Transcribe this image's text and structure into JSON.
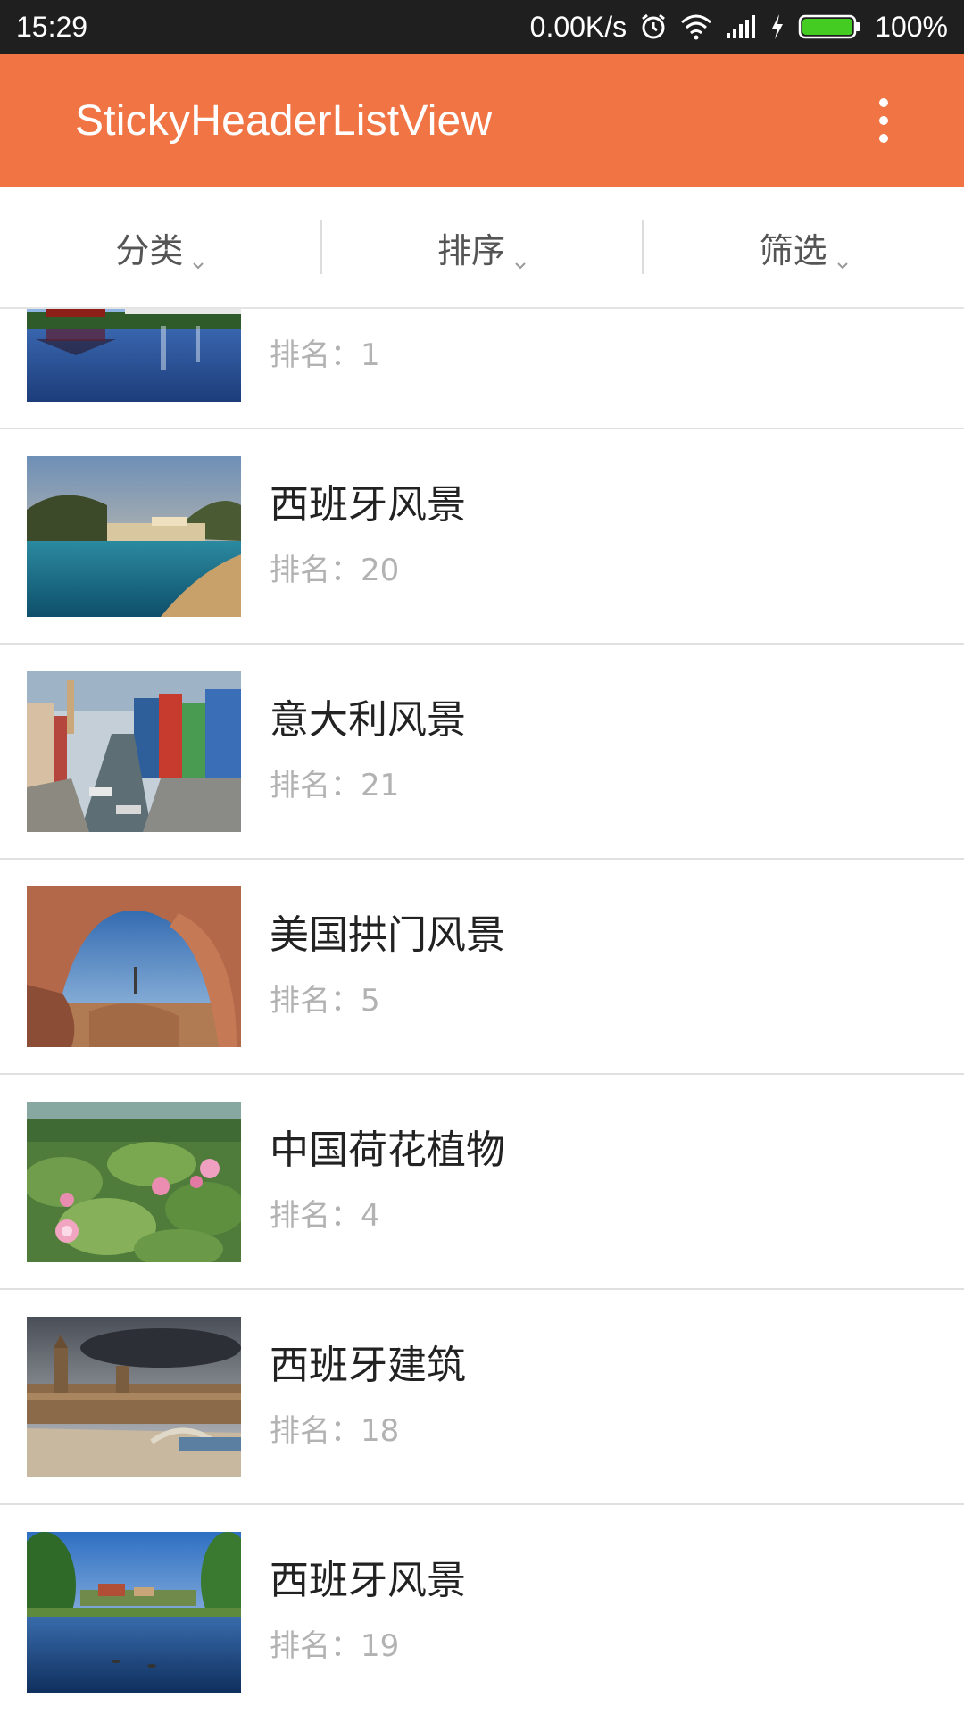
{
  "status_bar": {
    "time": "15:29",
    "network_speed": "0.00K/s",
    "battery_percent": "100%",
    "icons": [
      "alarm-icon",
      "wifi-icon",
      "signal-icon",
      "charging-icon",
      "battery-icon"
    ],
    "battery_level": 1.0
  },
  "app_bar": {
    "title": "StickyHeaderListView",
    "menu_icon": "overflow-menu-icon",
    "color": "#f07444"
  },
  "filters": [
    {
      "label": "分类",
      "icon": "chevron-down-icon"
    },
    {
      "label": "排序",
      "icon": "chevron-down-icon"
    },
    {
      "label": "筛选",
      "icon": "chevron-down-icon"
    }
  ],
  "list": {
    "items": [
      {
        "title": "",
        "rank": "排名：1",
        "thumbnail": "pagoda-lake-photo"
      },
      {
        "title": "西班牙风景",
        "rank": "排名：20",
        "thumbnail": "coast-beach-photo"
      },
      {
        "title": "意大利风景",
        "rank": "排名：21",
        "thumbnail": "canal-houses-photo"
      },
      {
        "title": "美国拱门风景",
        "rank": "排名：5",
        "thumbnail": "rock-arch-photo"
      },
      {
        "title": "中国荷花植物",
        "rank": "排名：4",
        "thumbnail": "lotus-pond-photo"
      },
      {
        "title": "西班牙建筑",
        "rank": "排名：18",
        "thumbnail": "plaza-building-photo"
      },
      {
        "title": "西班牙风景",
        "rank": "排名：19",
        "thumbnail": "lake-village-photo"
      }
    ]
  }
}
